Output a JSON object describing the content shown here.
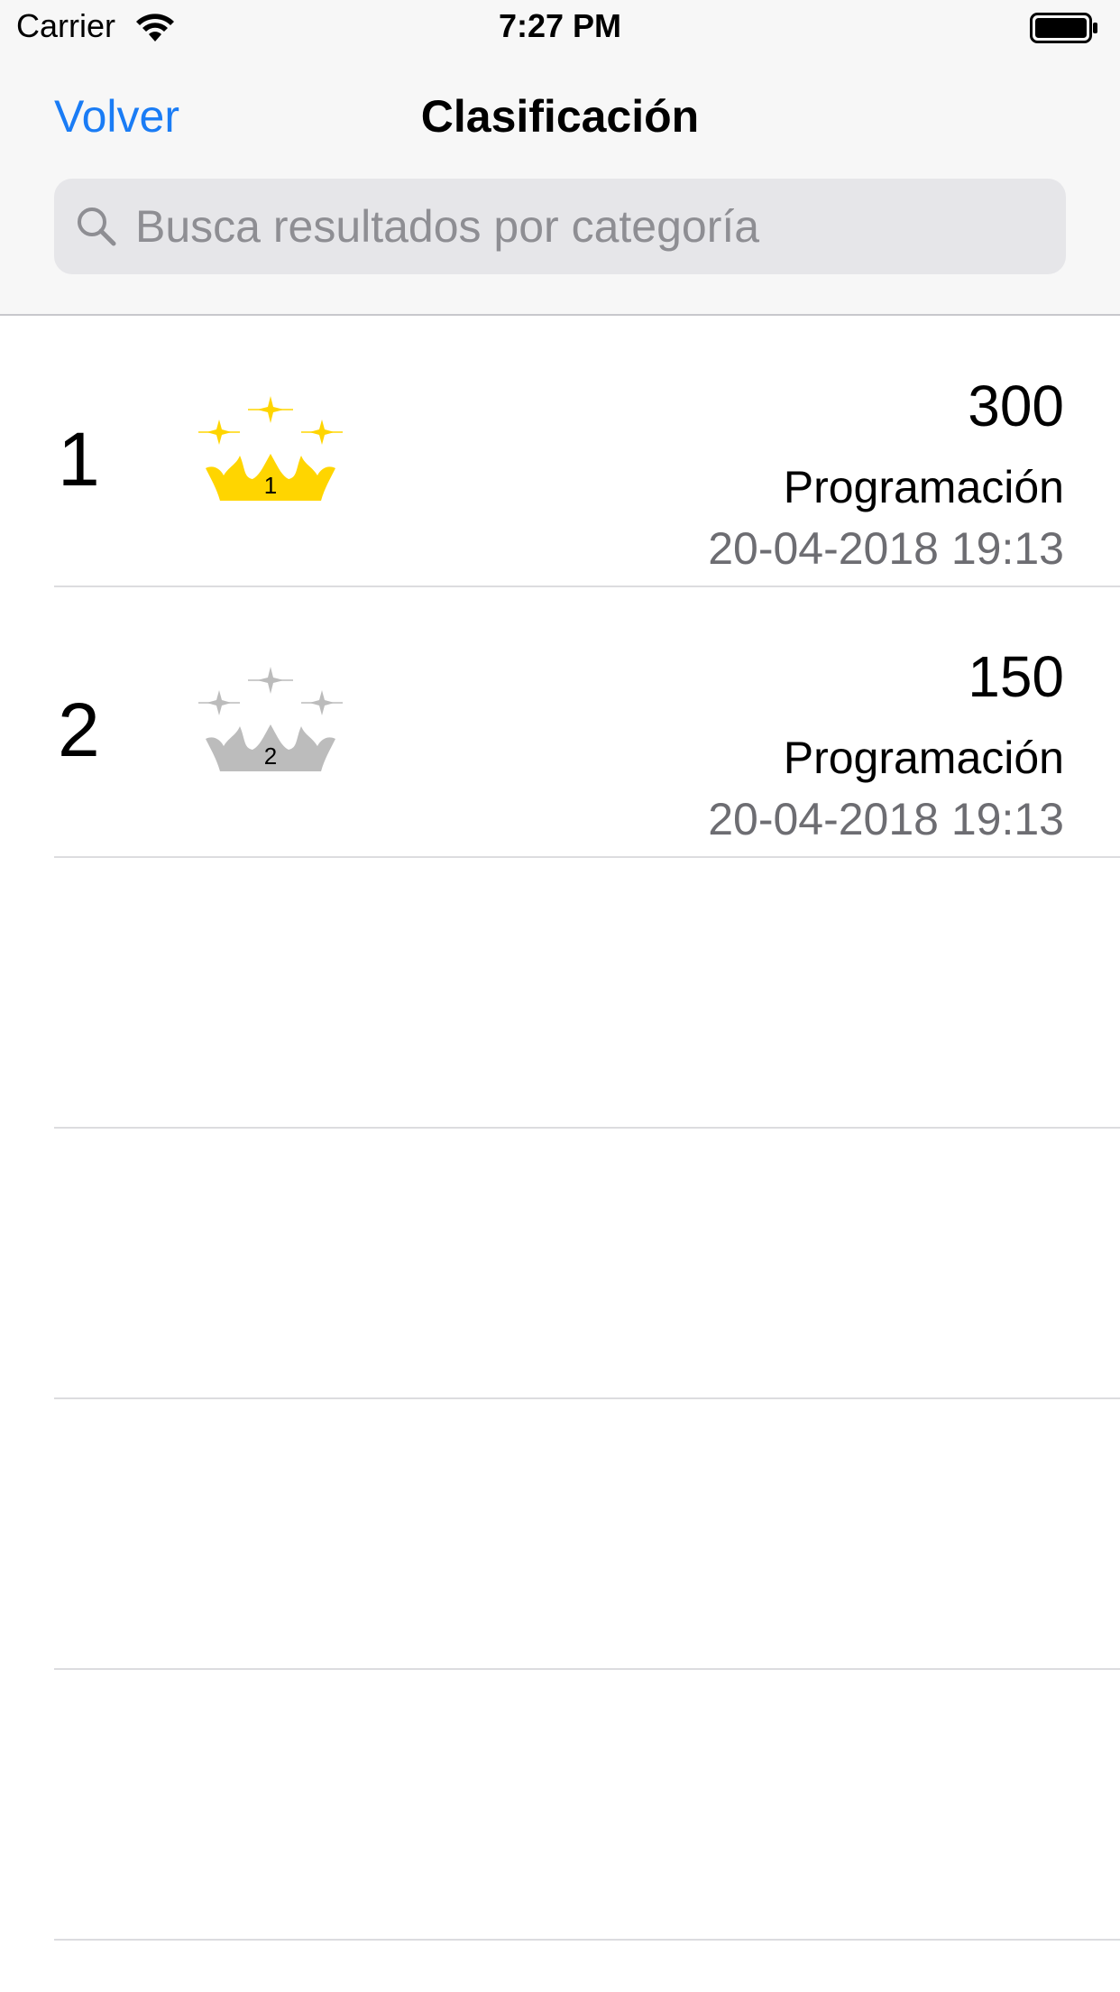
{
  "status_bar": {
    "carrier": "Carrier",
    "time": "7:27 PM"
  },
  "nav": {
    "back_label": "Volver",
    "title": "Clasificación"
  },
  "search": {
    "placeholder": "Busca resultados por categoría",
    "value": ""
  },
  "rankings": [
    {
      "rank": "1",
      "badge": "1",
      "crown_color": "#ffd500",
      "score": "300",
      "category": "Programación",
      "date": "20-04-2018 19:13"
    },
    {
      "rank": "2",
      "badge": "2",
      "crown_color": "#bcbcbc",
      "score": "150",
      "category": "Programación",
      "date": "20-04-2018 19:13"
    }
  ],
  "colors": {
    "accent": "#1a7cf5",
    "secondary_text": "#6d6d72",
    "gold": "#ffd500",
    "silver": "#bcbcbc"
  }
}
